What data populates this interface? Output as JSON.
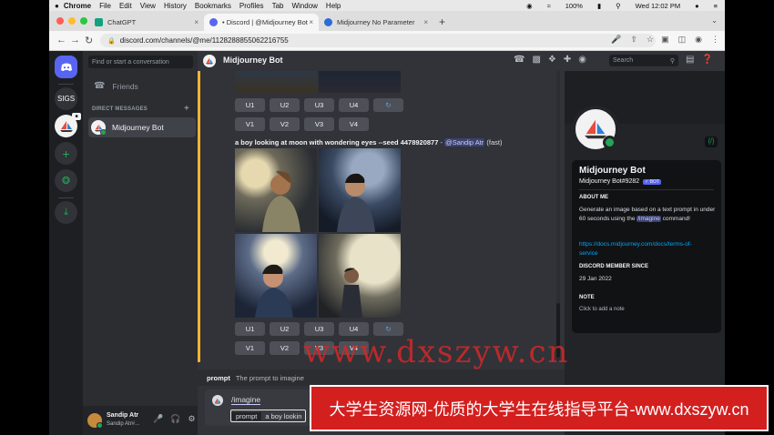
{
  "menubar": {
    "app": "Chrome",
    "items": [
      "File",
      "Edit",
      "View",
      "History",
      "Bookmarks",
      "Profiles",
      "Tab",
      "Window",
      "Help"
    ],
    "battery": "100%",
    "clock": "Wed 12:02 PM"
  },
  "tabs": [
    {
      "label": "ChatGPT",
      "color": "#10a37f"
    },
    {
      "label": "• Discord | @Midjourney Bot",
      "color": "#5865f2"
    },
    {
      "label": "Midjourney No Parameter",
      "color": "#2d6bd6"
    }
  ],
  "address": {
    "url": "discord.com/channels/@me/1128288855062216755"
  },
  "servers": {
    "sigs_label": "SIGS",
    "accent": "#5865f2",
    "green": "#23a559"
  },
  "channels": {
    "search_placeholder": "Find or start a conversation",
    "friends_label": "Friends",
    "dm_header": "DIRECT MESSAGES",
    "dm_item": "Midjourney Bot"
  },
  "user": {
    "name": "Sandip Atr",
    "tag": "Sandip Atr#..."
  },
  "header": {
    "title": "Midjourney Bot",
    "search_placeholder": "Search"
  },
  "message": {
    "prompt_text": "a boy looking at moon with wondering eyes --seed 4478920877",
    "separator": " - ",
    "mention": "@Sandip Atr",
    "mode": "(fast)"
  },
  "buttons": {
    "upscale": [
      "U1",
      "U2",
      "U3",
      "U4"
    ],
    "variation": [
      "V1",
      "V2",
      "V3",
      "V4"
    ],
    "refresh_icon": "refresh-icon"
  },
  "command_hint": {
    "name": "prompt",
    "description": "The prompt to imagine"
  },
  "input": {
    "command": "/imagine",
    "param_label": "prompt",
    "param_value": "a boy lookin"
  },
  "profile": {
    "name": "Midjourney Bot",
    "tag": "Midjourney Bot#9282",
    "bot_badge": "✓ BOT",
    "about_header": "ABOUT ME",
    "about_text_1": "Generate an image based on a text prompt in under 60 seconds using the",
    "about_command": "/imagine",
    "about_text_2": "command!",
    "link_1": "https://docs.midjourney.com/docs/terms-of-",
    "link_2": "service",
    "member_header": "DISCORD MEMBER SINCE",
    "member_date": "29 Jan 2022",
    "note_header": "NOTE",
    "note_placeholder": "Click to add a note"
  },
  "overlay": {
    "watermark": "www.dxszyw.cn",
    "banner": "大学生资源网-优质的大学生在线指导平台-www.dxszyw.cn"
  }
}
